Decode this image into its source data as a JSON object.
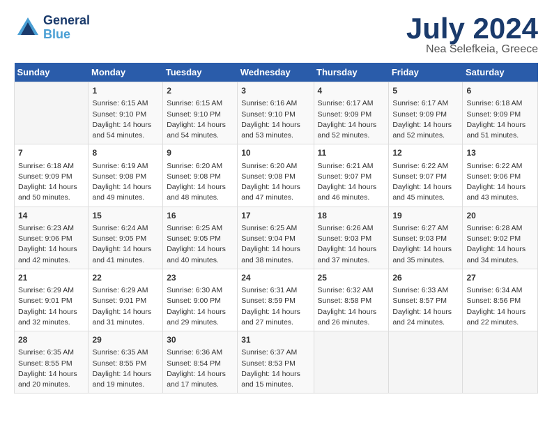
{
  "header": {
    "logo_general": "General",
    "logo_blue": "Blue",
    "month": "July 2024",
    "location": "Nea Selefkeia, Greece"
  },
  "days_of_week": [
    "Sunday",
    "Monday",
    "Tuesday",
    "Wednesday",
    "Thursday",
    "Friday",
    "Saturday"
  ],
  "weeks": [
    [
      {
        "day": "",
        "info": ""
      },
      {
        "day": "1",
        "info": "Sunrise: 6:15 AM\nSunset: 9:10 PM\nDaylight: 14 hours\nand 54 minutes."
      },
      {
        "day": "2",
        "info": "Sunrise: 6:15 AM\nSunset: 9:10 PM\nDaylight: 14 hours\nand 54 minutes."
      },
      {
        "day": "3",
        "info": "Sunrise: 6:16 AM\nSunset: 9:10 PM\nDaylight: 14 hours\nand 53 minutes."
      },
      {
        "day": "4",
        "info": "Sunrise: 6:17 AM\nSunset: 9:09 PM\nDaylight: 14 hours\nand 52 minutes."
      },
      {
        "day": "5",
        "info": "Sunrise: 6:17 AM\nSunset: 9:09 PM\nDaylight: 14 hours\nand 52 minutes."
      },
      {
        "day": "6",
        "info": "Sunrise: 6:18 AM\nSunset: 9:09 PM\nDaylight: 14 hours\nand 51 minutes."
      }
    ],
    [
      {
        "day": "7",
        "info": "Sunrise: 6:18 AM\nSunset: 9:09 PM\nDaylight: 14 hours\nand 50 minutes."
      },
      {
        "day": "8",
        "info": "Sunrise: 6:19 AM\nSunset: 9:08 PM\nDaylight: 14 hours\nand 49 minutes."
      },
      {
        "day": "9",
        "info": "Sunrise: 6:20 AM\nSunset: 9:08 PM\nDaylight: 14 hours\nand 48 minutes."
      },
      {
        "day": "10",
        "info": "Sunrise: 6:20 AM\nSunset: 9:08 PM\nDaylight: 14 hours\nand 47 minutes."
      },
      {
        "day": "11",
        "info": "Sunrise: 6:21 AM\nSunset: 9:07 PM\nDaylight: 14 hours\nand 46 minutes."
      },
      {
        "day": "12",
        "info": "Sunrise: 6:22 AM\nSunset: 9:07 PM\nDaylight: 14 hours\nand 45 minutes."
      },
      {
        "day": "13",
        "info": "Sunrise: 6:22 AM\nSunset: 9:06 PM\nDaylight: 14 hours\nand 43 minutes."
      }
    ],
    [
      {
        "day": "14",
        "info": "Sunrise: 6:23 AM\nSunset: 9:06 PM\nDaylight: 14 hours\nand 42 minutes."
      },
      {
        "day": "15",
        "info": "Sunrise: 6:24 AM\nSunset: 9:05 PM\nDaylight: 14 hours\nand 41 minutes."
      },
      {
        "day": "16",
        "info": "Sunrise: 6:25 AM\nSunset: 9:05 PM\nDaylight: 14 hours\nand 40 minutes."
      },
      {
        "day": "17",
        "info": "Sunrise: 6:25 AM\nSunset: 9:04 PM\nDaylight: 14 hours\nand 38 minutes."
      },
      {
        "day": "18",
        "info": "Sunrise: 6:26 AM\nSunset: 9:03 PM\nDaylight: 14 hours\nand 37 minutes."
      },
      {
        "day": "19",
        "info": "Sunrise: 6:27 AM\nSunset: 9:03 PM\nDaylight: 14 hours\nand 35 minutes."
      },
      {
        "day": "20",
        "info": "Sunrise: 6:28 AM\nSunset: 9:02 PM\nDaylight: 14 hours\nand 34 minutes."
      }
    ],
    [
      {
        "day": "21",
        "info": "Sunrise: 6:29 AM\nSunset: 9:01 PM\nDaylight: 14 hours\nand 32 minutes."
      },
      {
        "day": "22",
        "info": "Sunrise: 6:29 AM\nSunset: 9:01 PM\nDaylight: 14 hours\nand 31 minutes."
      },
      {
        "day": "23",
        "info": "Sunrise: 6:30 AM\nSunset: 9:00 PM\nDaylight: 14 hours\nand 29 minutes."
      },
      {
        "day": "24",
        "info": "Sunrise: 6:31 AM\nSunset: 8:59 PM\nDaylight: 14 hours\nand 27 minutes."
      },
      {
        "day": "25",
        "info": "Sunrise: 6:32 AM\nSunset: 8:58 PM\nDaylight: 14 hours\nand 26 minutes."
      },
      {
        "day": "26",
        "info": "Sunrise: 6:33 AM\nSunset: 8:57 PM\nDaylight: 14 hours\nand 24 minutes."
      },
      {
        "day": "27",
        "info": "Sunrise: 6:34 AM\nSunset: 8:56 PM\nDaylight: 14 hours\nand 22 minutes."
      }
    ],
    [
      {
        "day": "28",
        "info": "Sunrise: 6:35 AM\nSunset: 8:55 PM\nDaylight: 14 hours\nand 20 minutes."
      },
      {
        "day": "29",
        "info": "Sunrise: 6:35 AM\nSunset: 8:55 PM\nDaylight: 14 hours\nand 19 minutes."
      },
      {
        "day": "30",
        "info": "Sunrise: 6:36 AM\nSunset: 8:54 PM\nDaylight: 14 hours\nand 17 minutes."
      },
      {
        "day": "31",
        "info": "Sunrise: 6:37 AM\nSunset: 8:53 PM\nDaylight: 14 hours\nand 15 minutes."
      },
      {
        "day": "",
        "info": ""
      },
      {
        "day": "",
        "info": ""
      },
      {
        "day": "",
        "info": ""
      }
    ]
  ]
}
